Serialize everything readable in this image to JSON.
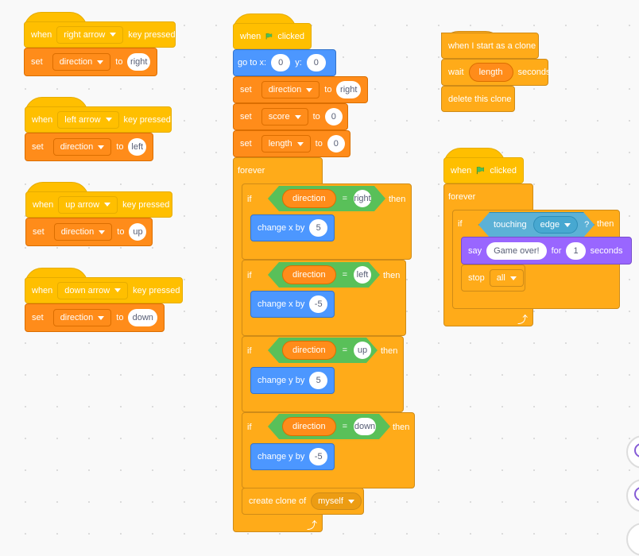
{
  "scripts": {
    "right_key": {
      "hat": {
        "when": "when",
        "key": "right arrow",
        "suffix": "key pressed"
      },
      "set": {
        "label": "set",
        "var": "direction",
        "to": "to",
        "value": "right"
      }
    },
    "left_key": {
      "hat": {
        "when": "when",
        "key": "left arrow",
        "suffix": "key pressed"
      },
      "set": {
        "label": "set",
        "var": "direction",
        "to": "to",
        "value": "left"
      }
    },
    "up_key": {
      "hat": {
        "when": "when",
        "key": "up arrow",
        "suffix": "key pressed"
      },
      "set": {
        "label": "set",
        "var": "direction",
        "to": "to",
        "value": "up"
      }
    },
    "down_key": {
      "hat": {
        "when": "when",
        "key": "down arrow",
        "suffix": "key pressed"
      },
      "set": {
        "label": "set",
        "var": "direction",
        "to": "to",
        "value": "down"
      }
    },
    "main": {
      "hat": {
        "when": "when",
        "suffix": "clicked"
      },
      "goto": {
        "label": "go to x:",
        "x": "0",
        "ylabel": "y:",
        "y": "0"
      },
      "set1": {
        "label": "set",
        "var": "direction",
        "to": "to",
        "value": "right"
      },
      "set2": {
        "label": "set",
        "var": "score",
        "to": "to",
        "value": "0"
      },
      "set3": {
        "label": "set",
        "var": "length",
        "to": "to",
        "value": "0"
      },
      "forever": "forever",
      "ifs": [
        {
          "if": "if",
          "var": "direction",
          "eq": "=",
          "value": "right",
          "then": "then",
          "action": "change x by",
          "amount": "5"
        },
        {
          "if": "if",
          "var": "direction",
          "eq": "=",
          "value": "left",
          "then": "then",
          "action": "change x by",
          "amount": "-5"
        },
        {
          "if": "if",
          "var": "direction",
          "eq": "=",
          "value": "up",
          "then": "then",
          "action": "change y by",
          "amount": "5"
        },
        {
          "if": "if",
          "var": "direction",
          "eq": "=",
          "value": "down",
          "then": "then",
          "action": "change y by",
          "amount": "-5"
        }
      ],
      "clone": {
        "label": "create clone of",
        "target": "myself"
      }
    },
    "clone_script": {
      "hat": "when I start as a clone",
      "wait": {
        "label": "wait",
        "var": "length",
        "suffix": "seconds"
      },
      "delete": "delete this clone"
    },
    "edge_script": {
      "hat": {
        "when": "when",
        "suffix": "clicked"
      },
      "forever": "forever",
      "if": {
        "if": "if",
        "touching": "touching",
        "target": "edge",
        "q": "?",
        "then": "then"
      },
      "say": {
        "label": "say",
        "message": "Game over!",
        "for": "for",
        "secs": "1",
        "suffix": "seconds"
      },
      "stop": {
        "label": "stop",
        "option": "all"
      }
    }
  },
  "colors": {
    "events": "#ffbf00",
    "variables": "#ff8c1a",
    "control": "#ffab19",
    "motion": "#4c97ff",
    "sensing": "#5cb1d6",
    "looks": "#9966ff",
    "operators": "#59c059"
  }
}
